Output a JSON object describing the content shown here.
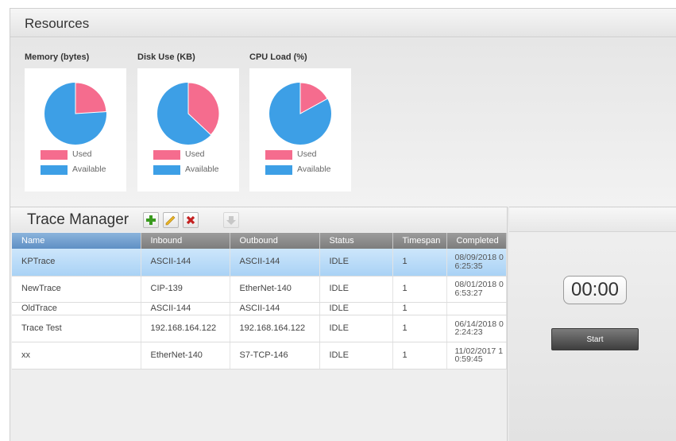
{
  "resources": {
    "title": "Resources",
    "charts": [
      {
        "label": "Memory (bytes)",
        "used_fraction": 0.24
      },
      {
        "label": "Disk Use (KB)",
        "used_fraction": 0.37
      },
      {
        "label": "CPU Load (%)",
        "used_fraction": 0.17
      }
    ],
    "legend": {
      "used": "Used",
      "available": "Available"
    },
    "colors": {
      "used": "#f56c8e",
      "available": "#3d9fe6"
    }
  },
  "trace_manager": {
    "title": "Trace Manager",
    "toolbar_icons": [
      "add-icon",
      "edit-icon",
      "delete-icon",
      "download-icon"
    ],
    "columns": [
      "Name",
      "Inbound",
      "Outbound",
      "Status",
      "Timespan",
      "Completed"
    ],
    "rows": [
      {
        "name": "KPTrace",
        "inbound": "ASCII-144",
        "outbound": "ASCII-144",
        "status": "IDLE",
        "timespan": "1",
        "completed": "08/09/2018 06:25:35"
      },
      {
        "name": "NewTrace",
        "inbound": "CIP-139",
        "outbound": "EtherNet-140",
        "status": "IDLE",
        "timespan": "1",
        "completed": "08/01/2018 06:53:27"
      },
      {
        "name": "OldTrace",
        "inbound": "ASCII-144",
        "outbound": "ASCII-144",
        "status": "IDLE",
        "timespan": "1",
        "completed": ""
      },
      {
        "name": "Trace Test",
        "inbound": "192.168.164.122",
        "outbound": "192.168.164.122",
        "status": "IDLE",
        "timespan": "1",
        "completed": "06/14/2018 02:24:23"
      },
      {
        "name": "xx",
        "inbound": "EtherNet-140",
        "outbound": "S7-TCP-146",
        "status": "IDLE",
        "timespan": "1",
        "completed": "11/02/2017 10:59:45"
      }
    ]
  },
  "timer": {
    "display": "00:00",
    "start_label": "Start"
  }
}
